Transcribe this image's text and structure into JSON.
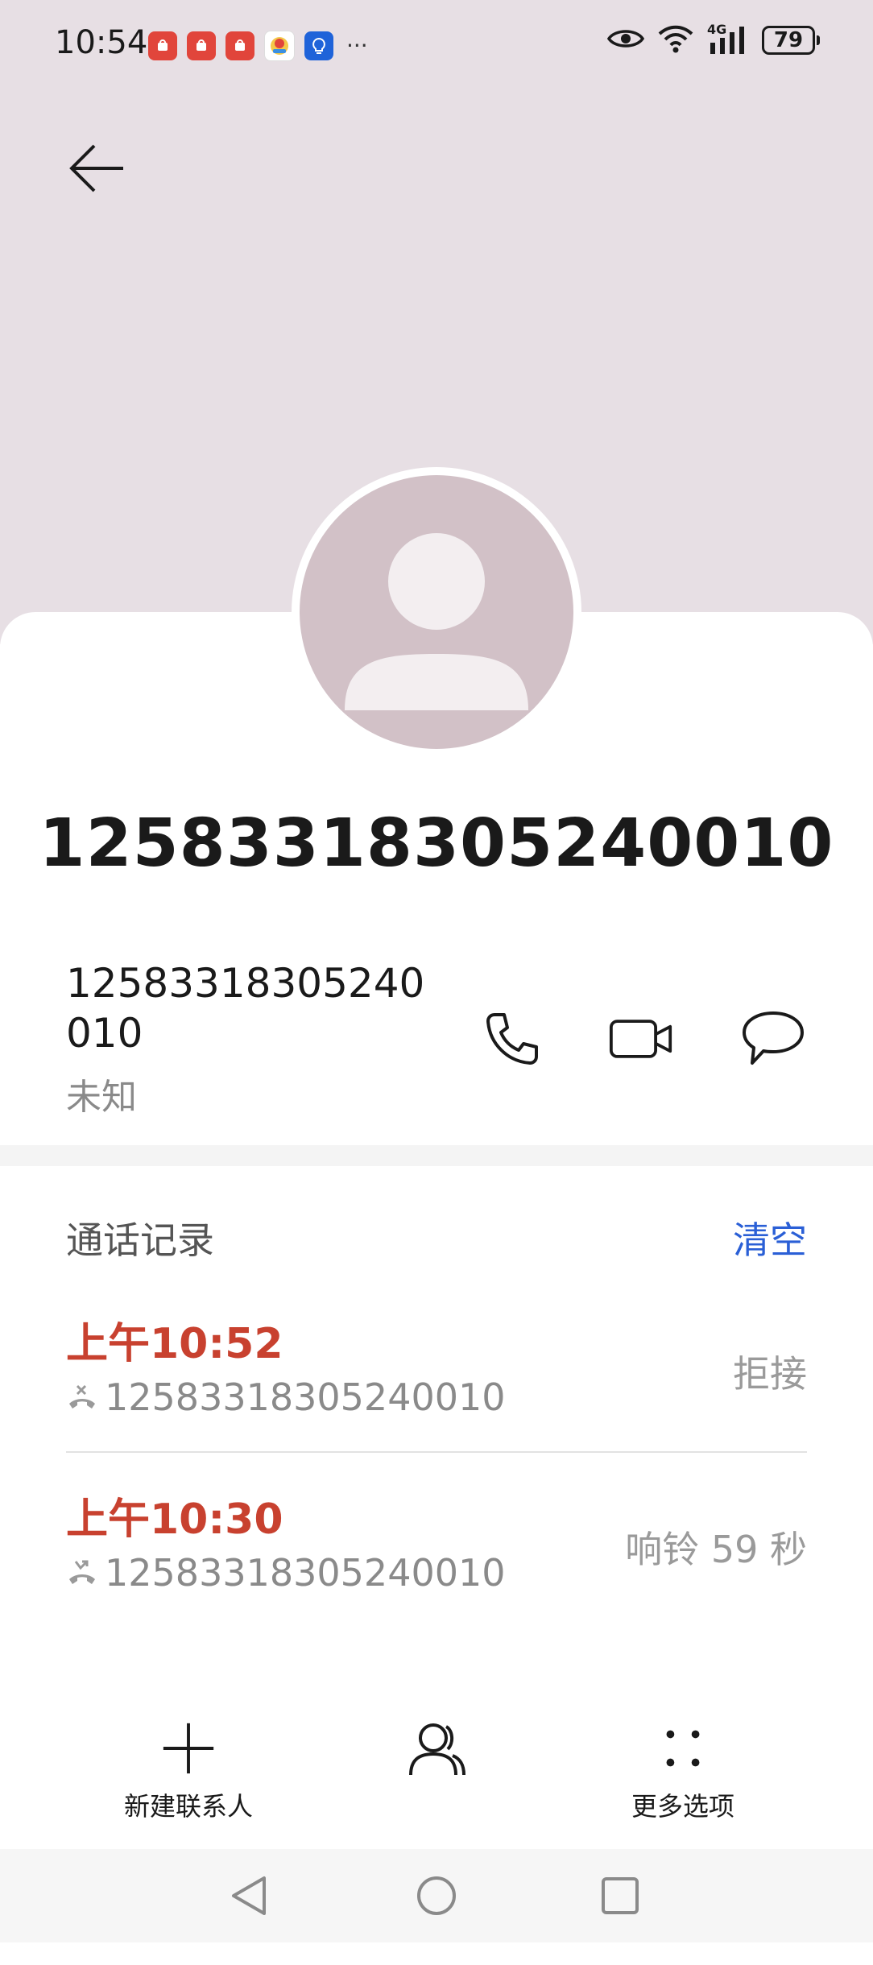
{
  "status_bar": {
    "time": "10:54",
    "notification_icons": [
      "huawei-app-icon",
      "huawei-app-icon",
      "huawei-app-icon",
      "game-app-icon",
      "tips-app-icon"
    ],
    "more": "···",
    "battery": "79",
    "network": "4G"
  },
  "header": {
    "back_icon": "arrow-left-icon"
  },
  "contact": {
    "title": "12583318305240010",
    "number": "12583318305240010",
    "number_label": "未知",
    "actions": [
      "phone-icon",
      "video-call-icon",
      "message-icon"
    ]
  },
  "call_log": {
    "title": "通话记录",
    "clear_label": "清空",
    "entries": [
      {
        "time": "上午10:52",
        "number": "12583318305240010",
        "status": "拒接"
      },
      {
        "time": "上午10:30",
        "number": "12583318305240010",
        "status": "响铃 59 秒"
      }
    ]
  },
  "toolbar": {
    "new_contact": "新建联系人",
    "more_options": "更多选项"
  },
  "colors": {
    "header_bg": "#e7dfe4",
    "avatar_bg": "#d2c1c7",
    "accent_red": "#c8412f",
    "link_blue": "#2a5fd6"
  }
}
